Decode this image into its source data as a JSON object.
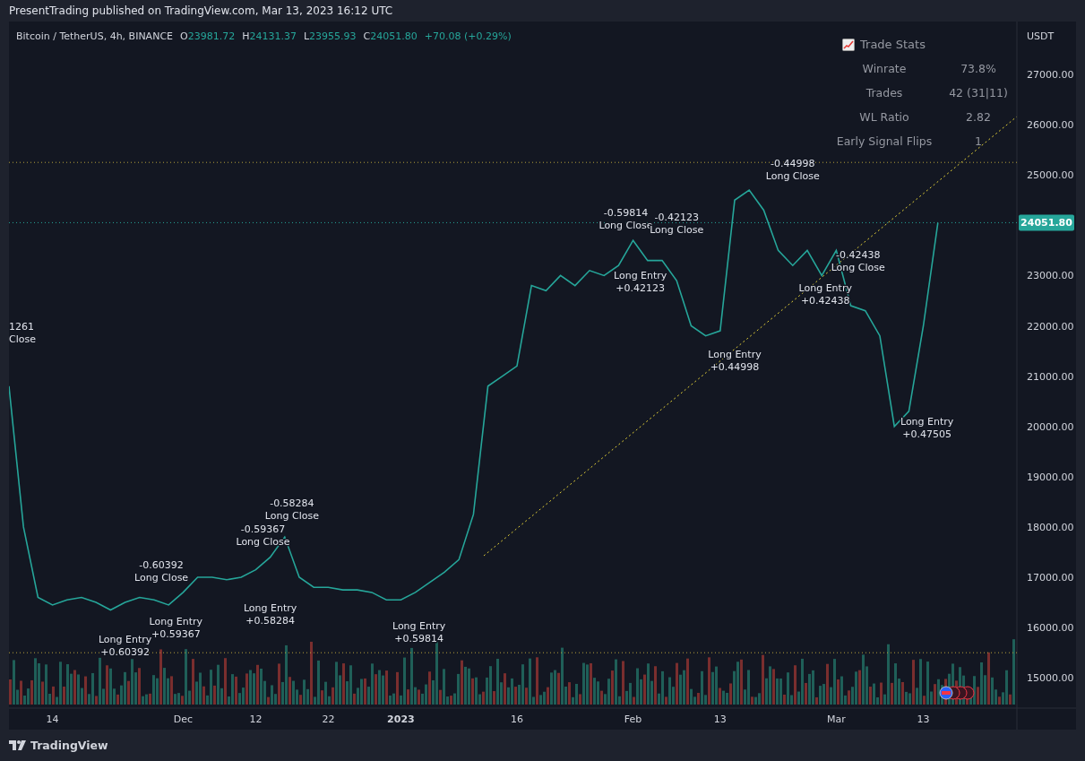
{
  "header": {
    "publisher_line": "PresentTrading published on TradingView.com, Mar 13, 2023 16:12 UTC"
  },
  "legend": {
    "symbol": "Bitcoin / TetherUS, 4h, BINANCE",
    "ohlc": [
      {
        "label": "O",
        "value": "23981.72"
      },
      {
        "label": "H",
        "value": "24131.37"
      },
      {
        "label": "L",
        "value": "23955.93"
      },
      {
        "label": "C",
        "value": "24051.80"
      }
    ],
    "change": "+70.08 (+0.29%)"
  },
  "trade_stats": {
    "title": "Trade Stats",
    "rows": [
      {
        "label": "Winrate",
        "value": "73.8%"
      },
      {
        "label": "Trades",
        "value": "42 (31|11)"
      },
      {
        "label": "WL Ratio",
        "value": "2.82"
      },
      {
        "label": "Early Signal Flips",
        "value": "1"
      }
    ]
  },
  "price_axis": {
    "unit": "USDT",
    "last_price": "24051.80"
  },
  "chart_data": {
    "type": "line",
    "ylim": [
      14398,
      28052
    ],
    "categories": [
      null,
      null,
      null,
      "14",
      null,
      null,
      null,
      null,
      null,
      null,
      null,
      null,
      "Dec",
      null,
      null,
      null,
      null,
      "12",
      null,
      null,
      null,
      null,
      "22",
      null,
      null,
      null,
      null,
      "2023",
      null,
      null,
      null,
      null,
      null,
      null,
      null,
      "16",
      null,
      null,
      null,
      null,
      null,
      null,
      null,
      "Feb",
      null,
      null,
      null,
      null,
      null,
      "13",
      null,
      null,
      null,
      null,
      null,
      null,
      null,
      "Mar",
      null,
      null,
      null,
      null,
      null,
      "13",
      null
    ],
    "series": [
      {
        "color": "#26a69a",
        "values": [
          20800,
          18000,
          16600,
          16450,
          16550,
          16600,
          16500,
          16350,
          16500,
          16600,
          16550,
          16450,
          16700,
          17000,
          17000,
          16950,
          17000,
          17150,
          17400,
          17800,
          17000,
          16800,
          16800,
          16750,
          16750,
          16700,
          16550,
          16550,
          16700,
          16900,
          17100,
          17350,
          18250,
          20800,
          21000,
          21200,
          22800,
          22700,
          23000,
          22800,
          23100,
          23000,
          23200,
          23700,
          23300,
          23300,
          22900,
          22000,
          21800,
          21900,
          24500,
          24700,
          24300,
          23500,
          23200,
          23500,
          23000,
          23500,
          22400,
          22300,
          21800,
          20000,
          20300,
          22000,
          24050
        ]
      }
    ],
    "yticks": [
      {
        "value": 15000,
        "label": "15000.00"
      },
      {
        "value": 16000,
        "label": "16000.00"
      },
      {
        "value": 17000,
        "label": "17000.00"
      },
      {
        "value": 18000,
        "label": "18000.00"
      },
      {
        "value": 19000,
        "label": "19000.00"
      },
      {
        "value": 20000,
        "label": "20000.00"
      },
      {
        "value": 21000,
        "label": "21000.00"
      },
      {
        "value": 22000,
        "label": "22000.00"
      },
      {
        "value": 23000,
        "label": "23000.00"
      },
      {
        "value": 25000,
        "label": "25000.00"
      },
      {
        "value": 26000,
        "label": "26000.00"
      },
      {
        "value": 27000,
        "label": "27000.00"
      }
    ],
    "ref_lines": [
      {
        "axis": "y",
        "value": 25250,
        "color": "#b9a23a"
      },
      {
        "axis": "y",
        "value": 24051.8,
        "color": "#26a69a"
      },
      {
        "axis": "y",
        "value": 15500,
        "color": "#b9a23a"
      }
    ],
    "annotations": [
      "1261",
      "Close",
      "-0.60392",
      "Long Close",
      "Long Entry",
      "+0.60392",
      "Long Entry",
      "+0.59367",
      "-0.59367",
      "Long Close",
      "-0.58284",
      "Long Close",
      "Long Entry",
      "+0.58284",
      "Long Entry",
      "+0.59814",
      "-0.59814",
      "Long Close",
      "-0.42123",
      "Long Close",
      "Long Entry",
      "+0.42123",
      "Long Entry",
      "+0.44998",
      "-0.44998",
      "Long Close",
      "-0.42438",
      "Long Close",
      "Long Entry",
      "+0.42438",
      "Long Entry",
      "+0.47505"
    ]
  },
  "footer": {
    "brand": "TradingView"
  }
}
